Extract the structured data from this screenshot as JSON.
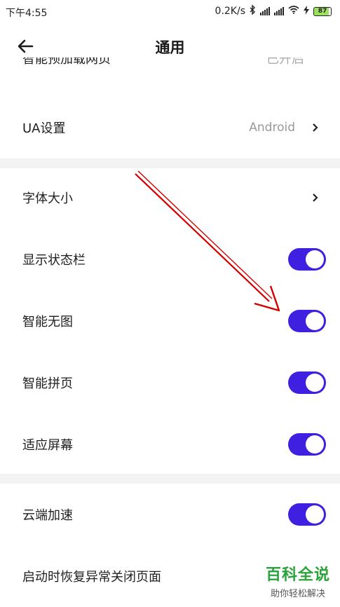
{
  "status": {
    "time": "下午4:55",
    "network_speed": "0.2K/s",
    "battery_level": "87"
  },
  "header": {
    "title": "通用"
  },
  "settings": {
    "clipped_row": {
      "label": "智能预加载网页",
      "value": "已开启"
    },
    "ua": {
      "label": "UA设置",
      "value": "Android"
    },
    "font_size": {
      "label": "字体大小"
    },
    "show_status_bar": {
      "label": "显示状态栏",
      "on": true
    },
    "smart_no_image": {
      "label": "智能无图",
      "on": true
    },
    "smart_page_join": {
      "label": "智能拼页",
      "on": true
    },
    "fit_screen": {
      "label": "适应屏幕",
      "on": true
    },
    "cloud_accel": {
      "label": "云端加速",
      "on": true
    },
    "restore_pages": {
      "label": "启动时恢复异常关闭页面"
    }
  },
  "watermark": {
    "main": "百科全说",
    "sub": "助你轻松解决"
  },
  "colors": {
    "toggle_on": "#3f1fe0",
    "annotation_arrow": "#d40000",
    "watermark_green": "#2aa33a"
  }
}
